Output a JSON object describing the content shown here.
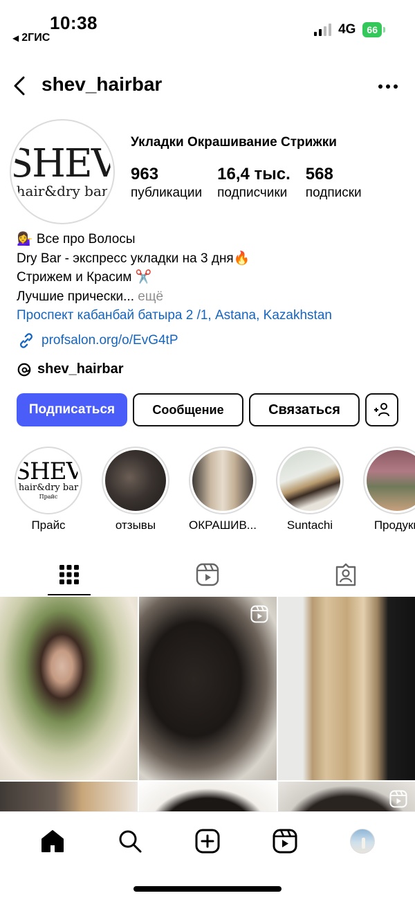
{
  "status_bar": {
    "time": "10:38",
    "back_app": "2ГИС",
    "network": "4G",
    "battery": "66"
  },
  "header": {
    "username": "shev_hairbar",
    "back_icon": "chevron-left-icon",
    "more_icon": "more-horizontal-icon"
  },
  "profile": {
    "avatar_logo_top": "SHEV",
    "avatar_logo_bottom": "hair&dry bar",
    "category": "Укладки Окрашивание Стрижки",
    "stats": [
      {
        "value": "963",
        "label": "публикации"
      },
      {
        "value": "16,4 тыс.",
        "label": "подписчики"
      },
      {
        "value": "568",
        "label": "подписки"
      }
    ]
  },
  "bio": {
    "line1": "💁‍♀️ Все про Волосы",
    "line2": "Dry Bar - экспресс укладки на 3 дня🔥",
    "line3": "Стрижем и Красим ✂️",
    "line4": "Лучшие прически...",
    "more": " ещё",
    "address": "Проспект кабанбай батыра 2 /1, Astana, Kazakhstan",
    "link": "profsalon.org/o/EvG4tP",
    "threads": "shev_hairbar"
  },
  "buttons": {
    "follow": "Подписаться",
    "message": "Сообщение",
    "contact": "Связаться"
  },
  "highlights": [
    {
      "label": "Прайс",
      "logo_top": "SHEV",
      "logo_bottom": "hair&dry bar",
      "logo_note": "Прайс"
    },
    {
      "label": "отзывы"
    },
    {
      "label": "ОКРАШИВ..."
    },
    {
      "label": "Suntachi"
    },
    {
      "label": "Продукц"
    }
  ],
  "tabs": [
    "grid",
    "reels",
    "tagged"
  ],
  "bottom_nav": [
    "home",
    "search",
    "create",
    "reels",
    "profile"
  ],
  "colors": {
    "accent": "#4a5df9",
    "link": "#1565c0",
    "muted": "#8e8e8e",
    "battery": "#34c759"
  }
}
